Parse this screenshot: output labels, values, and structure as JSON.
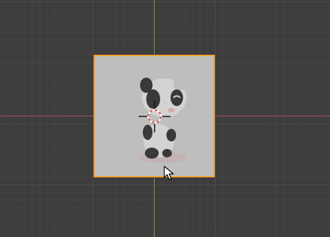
{
  "viewport": {
    "background": "#3d3d3d",
    "grid_major": "#4a4a4a",
    "grid_minor": "#434343",
    "axis_x_color": "#b0545a",
    "axis_y_color": "#7aa33e"
  },
  "image_plane": {
    "selection_color": "#f5a12e",
    "fill": "#bebebe",
    "subject": "panda-illustration"
  },
  "icons": {
    "cursor_3d": "3d-cursor-icon",
    "pointer": "mouse-pointer-icon"
  }
}
